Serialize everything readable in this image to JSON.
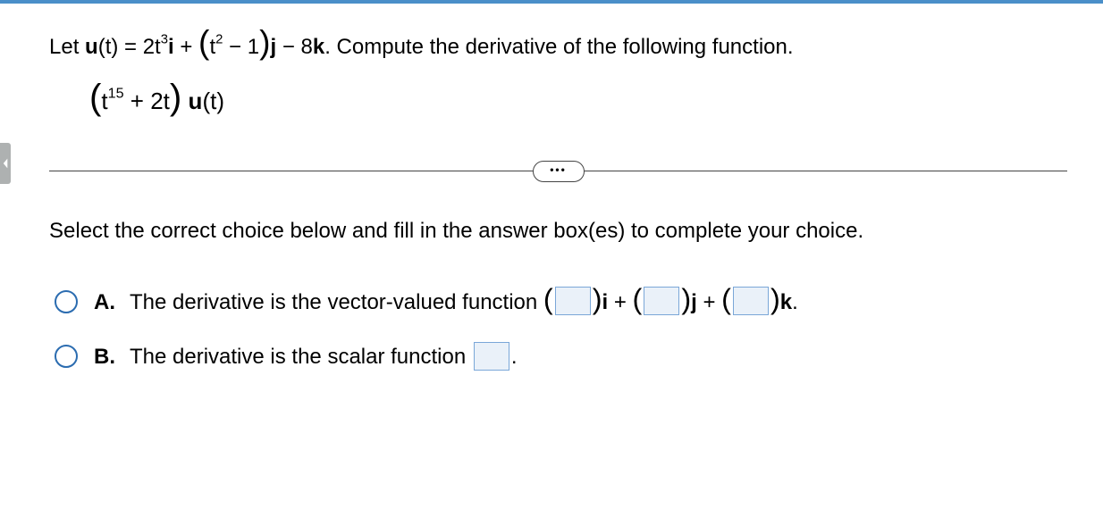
{
  "problem": {
    "lead": "Let ",
    "u_label": "u",
    "u_arg": "(t) = 2t",
    "exp3": "3",
    "i_unit": "i",
    "plus1": " + ",
    "open_paren": "(",
    "t_label": "t",
    "exp2": "2",
    "minus1": " − 1",
    "close_paren": ")",
    "j_unit": "j",
    "minus8k": " − 8",
    "k_unit": "k",
    "sentence_tail": ". Compute the derivative of the following function.",
    "second_open": "(",
    "second_t": "t",
    "exp15": "15",
    "plus2t": " + 2t",
    "second_close": ")",
    "u_of_t": " u",
    "u_of_t_arg": "(t)"
  },
  "divider": {
    "dots": "•••"
  },
  "instruction": "Select the correct choice below and fill in the answer box(es) to complete your choice.",
  "choices": {
    "a": {
      "label": "A.",
      "text_lead": "The derivative is the vector-valued function ",
      "i_sep": "i",
      "plus_a1": " + ",
      "j_sep": "j",
      "plus_a2": " + ",
      "k_sep": "k",
      "period": "."
    },
    "b": {
      "label": "B.",
      "text_lead": "The derivative is the scalar function ",
      "period": "."
    }
  }
}
